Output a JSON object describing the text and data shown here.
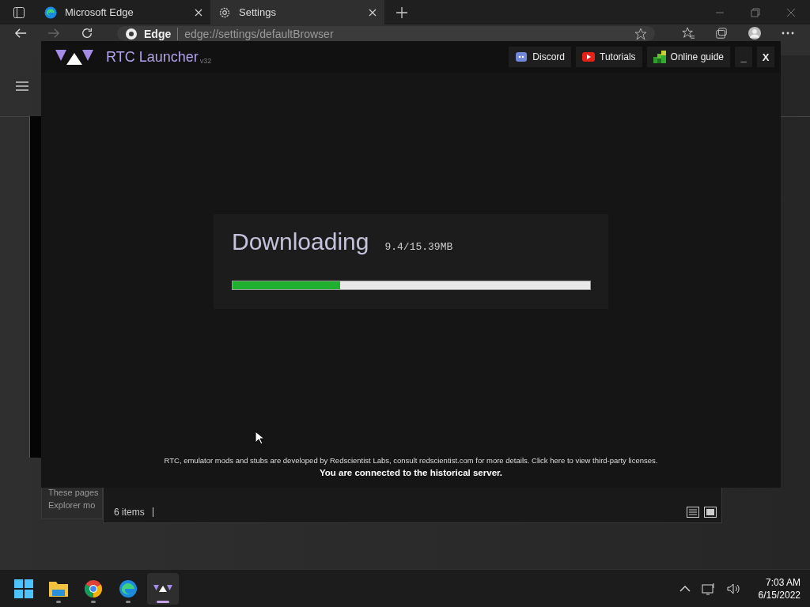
{
  "browser": {
    "tabs": [
      {
        "kind": "edge",
        "label": "Microsoft Edge",
        "selected": false
      },
      {
        "kind": "settings",
        "label": "Settings",
        "selected": true
      }
    ],
    "address": {
      "site": "Edge",
      "url": "edge://settings/defaultBrowser"
    }
  },
  "settings_page": {
    "text_lines": [
      "These pages",
      "Explorer mo"
    ]
  },
  "explorer": {
    "status": "6 items"
  },
  "launcher": {
    "title": "RTC Launcher",
    "version": "v32",
    "links": [
      {
        "kind": "discord",
        "label": "Discord"
      },
      {
        "kind": "youtube",
        "label": "Tutorials"
      },
      {
        "kind": "guide",
        "label": "Online guide"
      }
    ],
    "controls": [
      "_",
      "X"
    ],
    "download": {
      "label": "Downloading",
      "progress": "9.4/15.39MB",
      "level": 0.3
    },
    "footer": {
      "credits": "RTC, emulator mods and stubs are developed by Redscientist Labs, consult redscientist.com for more details. Click here to view third-party licenses.",
      "status": "You are connected to the historical server."
    }
  },
  "taskbar": {
    "apps": [
      {
        "kind": "start",
        "running": false,
        "selected": false
      },
      {
        "kind": "files",
        "running": true,
        "selected": false
      },
      {
        "kind": "chrome",
        "running": true,
        "selected": false
      },
      {
        "kind": "edge",
        "running": true,
        "selected": false
      },
      {
        "kind": "launcher",
        "running": true,
        "selected": true
      }
    ],
    "time": "7:03 AM",
    "date": "6/15/2022"
  }
}
